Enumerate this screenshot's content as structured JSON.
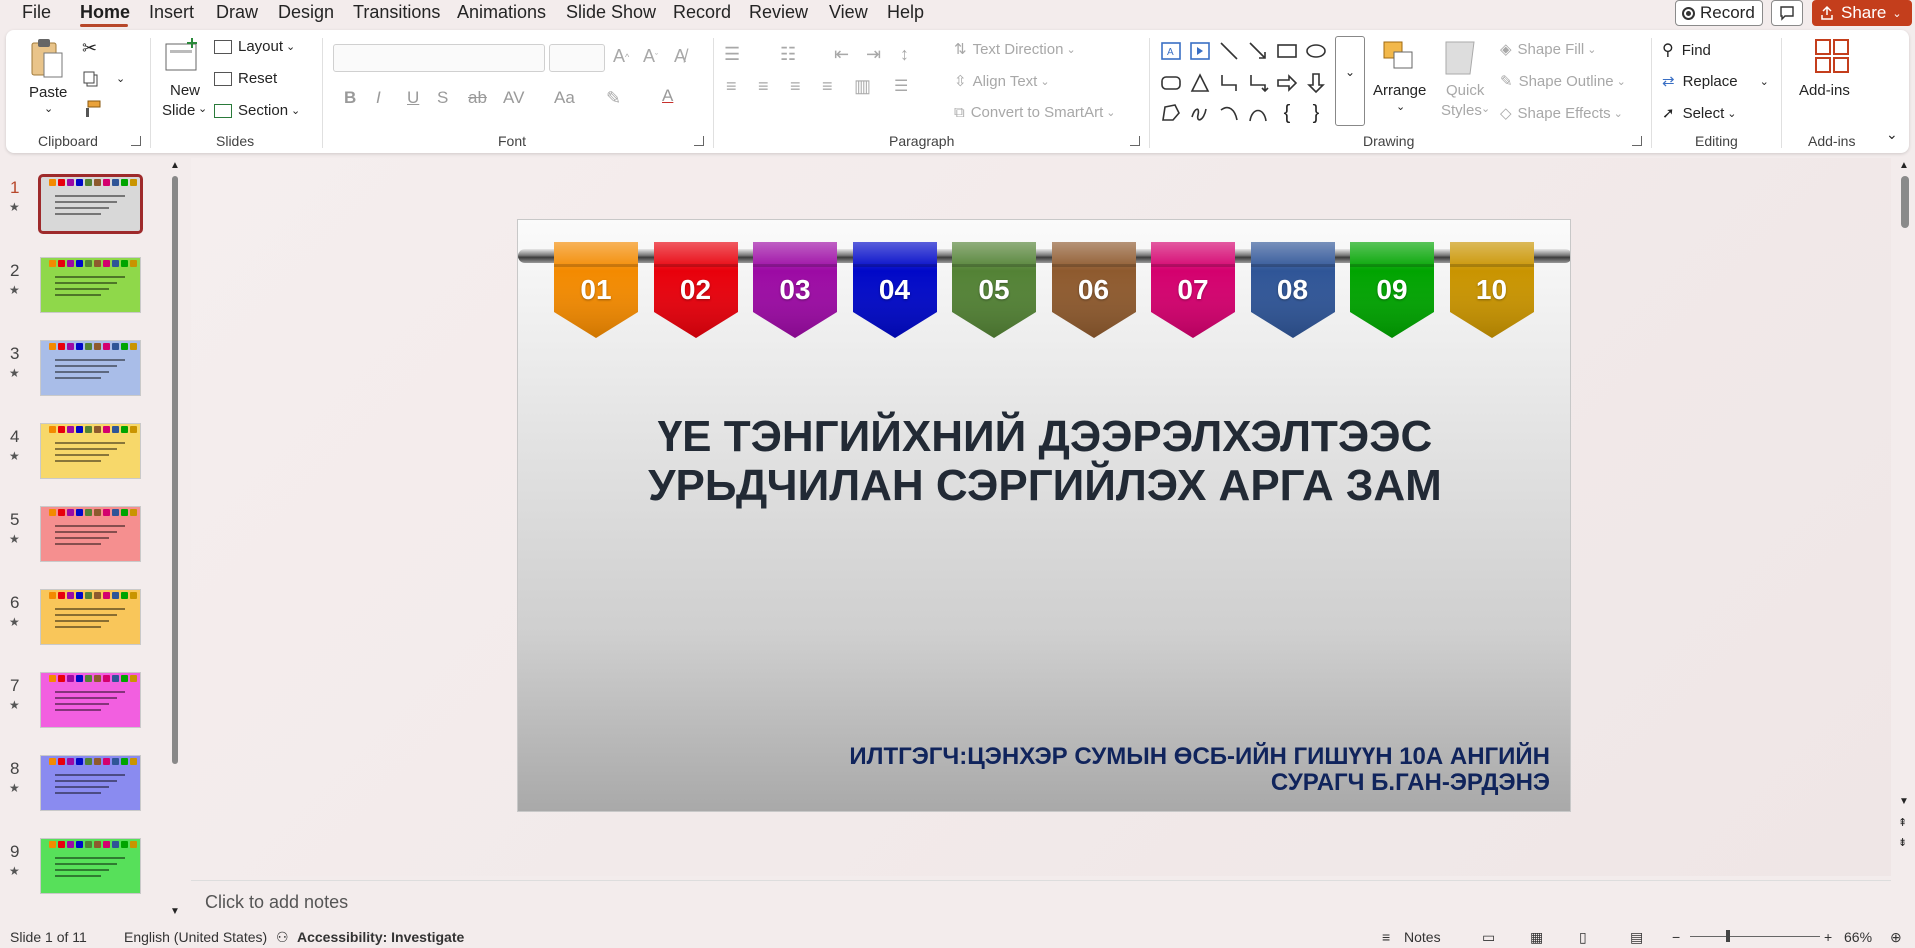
{
  "menu": {
    "tabs": [
      "File",
      "Home",
      "Insert",
      "Draw",
      "Design",
      "Transitions",
      "Animations",
      "Slide Show",
      "Record",
      "Review",
      "View",
      "Help"
    ],
    "active_tab": "Home",
    "record_label": "Record",
    "share_label": "Share"
  },
  "ribbon": {
    "clipboard": {
      "paste": "Paste",
      "label": "Clipboard"
    },
    "slides": {
      "new_slide_1": "New",
      "new_slide_2": "Slide",
      "layout": "Layout",
      "reset": "Reset",
      "section": "Section",
      "label": "Slides"
    },
    "font": {
      "label": "Font",
      "bold": "B",
      "italic": "I",
      "underline": "U",
      "shadow": "S",
      "strike": "ab",
      "spacing": "AV",
      "case": "Aa",
      "color_a": "A"
    },
    "paragraph": {
      "label": "Paragraph",
      "text_direction": "Text Direction",
      "align_text": "Align Text",
      "convert_smartart": "Convert to SmartArt"
    },
    "drawing": {
      "label": "Drawing",
      "arrange": "Arrange",
      "quick_styles_1": "Quick",
      "quick_styles_2": "Styles",
      "shape_fill": "Shape Fill",
      "shape_outline": "Shape Outline",
      "shape_effects": "Shape Effects"
    },
    "editing": {
      "label": "Editing",
      "find": "Find",
      "replace": "Replace",
      "select": "Select"
    },
    "addins": {
      "label": "Add-ins",
      "button": "Add-ins"
    }
  },
  "thumbnails": [
    {
      "num": "1",
      "bg": "#d8d8d8"
    },
    {
      "num": "2",
      "bg": "#8fd84a"
    },
    {
      "num": "3",
      "bg": "#a9bde8"
    },
    {
      "num": "4",
      "bg": "#f7d86a"
    },
    {
      "num": "5",
      "bg": "#f58f8f"
    },
    {
      "num": "6",
      "bg": "#f9c65a"
    },
    {
      "num": "7",
      "bg": "#f25fe0"
    },
    {
      "num": "8",
      "bg": "#8a8bf0"
    },
    {
      "num": "9",
      "bg": "#57e05a"
    }
  ],
  "slide": {
    "flags": [
      {
        "num": "01",
        "color": "#f38a00"
      },
      {
        "num": "02",
        "color": "#e8000b"
      },
      {
        "num": "03",
        "color": "#9c0aa4"
      },
      {
        "num": "04",
        "color": "#0008c8"
      },
      {
        "num": "05",
        "color": "#538235"
      },
      {
        "num": "06",
        "color": "#8e5a2e"
      },
      {
        "num": "07",
        "color": "#d4006e"
      },
      {
        "num": "08",
        "color": "#2f5597"
      },
      {
        "num": "09",
        "color": "#00a400"
      },
      {
        "num": "10",
        "color": "#c99400"
      }
    ],
    "title_line1": "ҮЕ ТЭНГИЙХНИЙ ДЭЭРЭЛХЭЛТЭЭС",
    "title_line2": "УРЬДЧИЛАН СЭРГИЙЛЭХ АРГА ЗАМ",
    "author_line1": "ИЛТГЭГЧ:ЦЭНХЭР СУМЫН ӨСБ-ИЙН ГИШҮҮН 10А АНГИЙН",
    "author_line2": "СУРАГЧ Б.ГАН-ЭРДЭНЭ"
  },
  "notes_placeholder": "Click to add notes",
  "status": {
    "slide_counter": "Slide 1 of 11",
    "language": "English (United States)",
    "accessibility": "Accessibility: Investigate",
    "notes": "Notes",
    "zoom": "66%"
  }
}
